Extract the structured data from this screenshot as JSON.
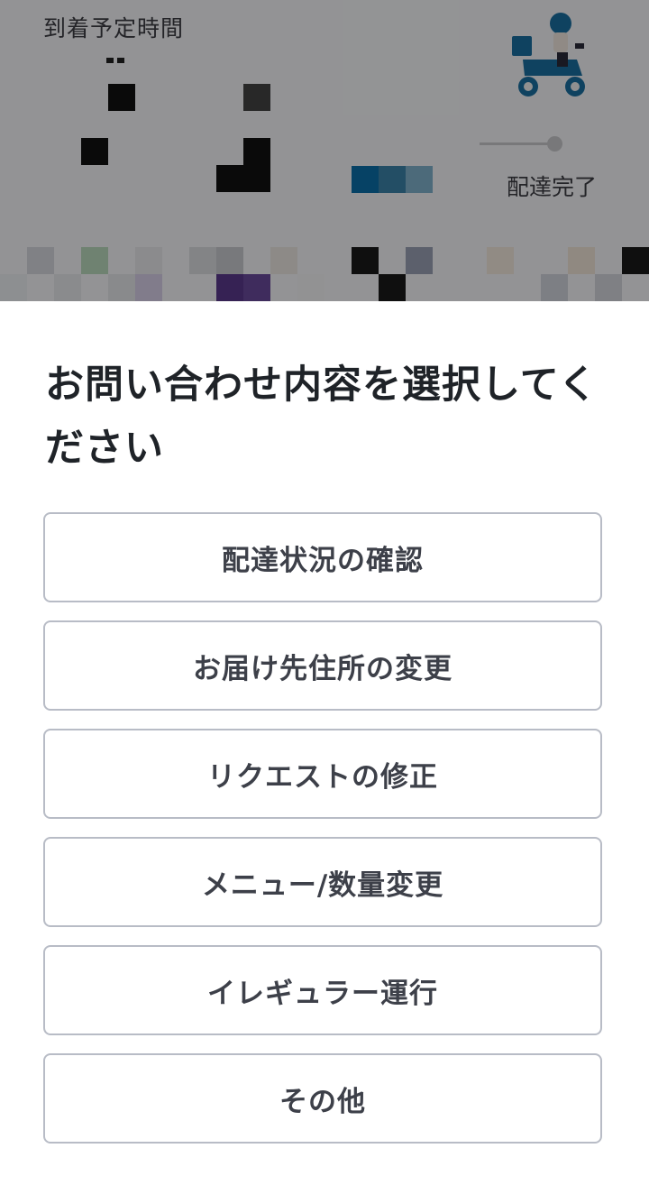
{
  "background": {
    "eta_label": "到着予定時間",
    "status_done_label": "配達完了"
  },
  "sheet": {
    "title": "お問い合わせ内容を選択してください",
    "options": [
      {
        "label": "配達状況の確認"
      },
      {
        "label": "お届け先住所の変更"
      },
      {
        "label": "リクエストの修正"
      },
      {
        "label": "メニュー/数量変更"
      },
      {
        "label": "イレギュラー運行"
      },
      {
        "label": "その他"
      }
    ]
  },
  "colors": {
    "scrim": "#000000",
    "option_border": "#b8bcc6",
    "title_text": "#1f2328",
    "option_text": "#3d4049"
  }
}
